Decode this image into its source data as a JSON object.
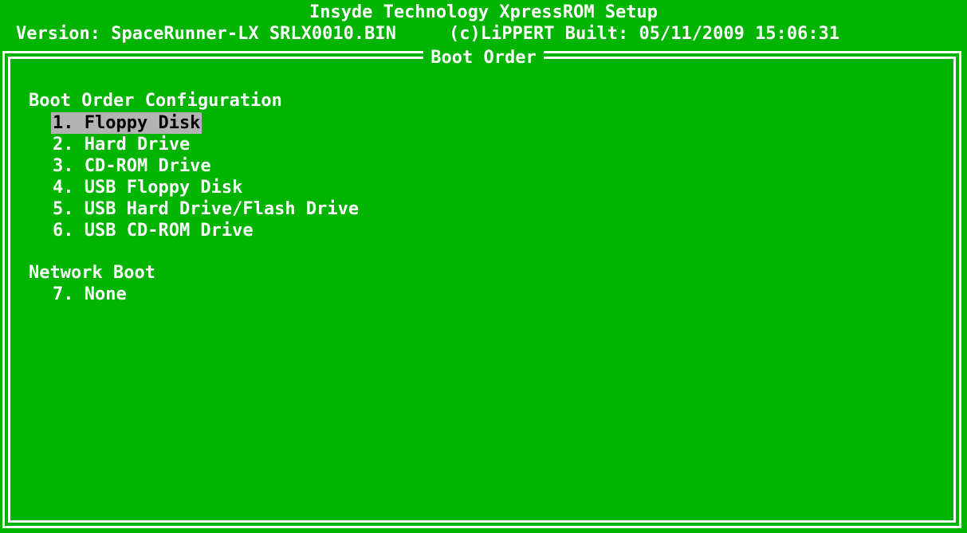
{
  "header": {
    "title": "Insyde Technology XpressROM Setup",
    "version_line": "Version: SpaceRunner-LX SRLX0010.BIN     (c)LiPPERT Built: 05/11/2009 15:06:31"
  },
  "panel": {
    "title": "Boot Order"
  },
  "boot_order": {
    "heading": "Boot Order Configuration",
    "items": [
      "1. Floppy Disk",
      "2. Hard Drive",
      "3. CD-ROM Drive",
      "4. USB Floppy Disk",
      "5. USB Hard Drive/Flash Drive",
      "6. USB CD-ROM Drive"
    ],
    "selected_index": 0
  },
  "network_boot": {
    "heading": "Network Boot",
    "items": [
      "7. None"
    ]
  },
  "colors": {
    "background": "#00b400",
    "text": "#ffffff",
    "highlight_bg": "#b3b3b3",
    "highlight_text": "#000000"
  }
}
